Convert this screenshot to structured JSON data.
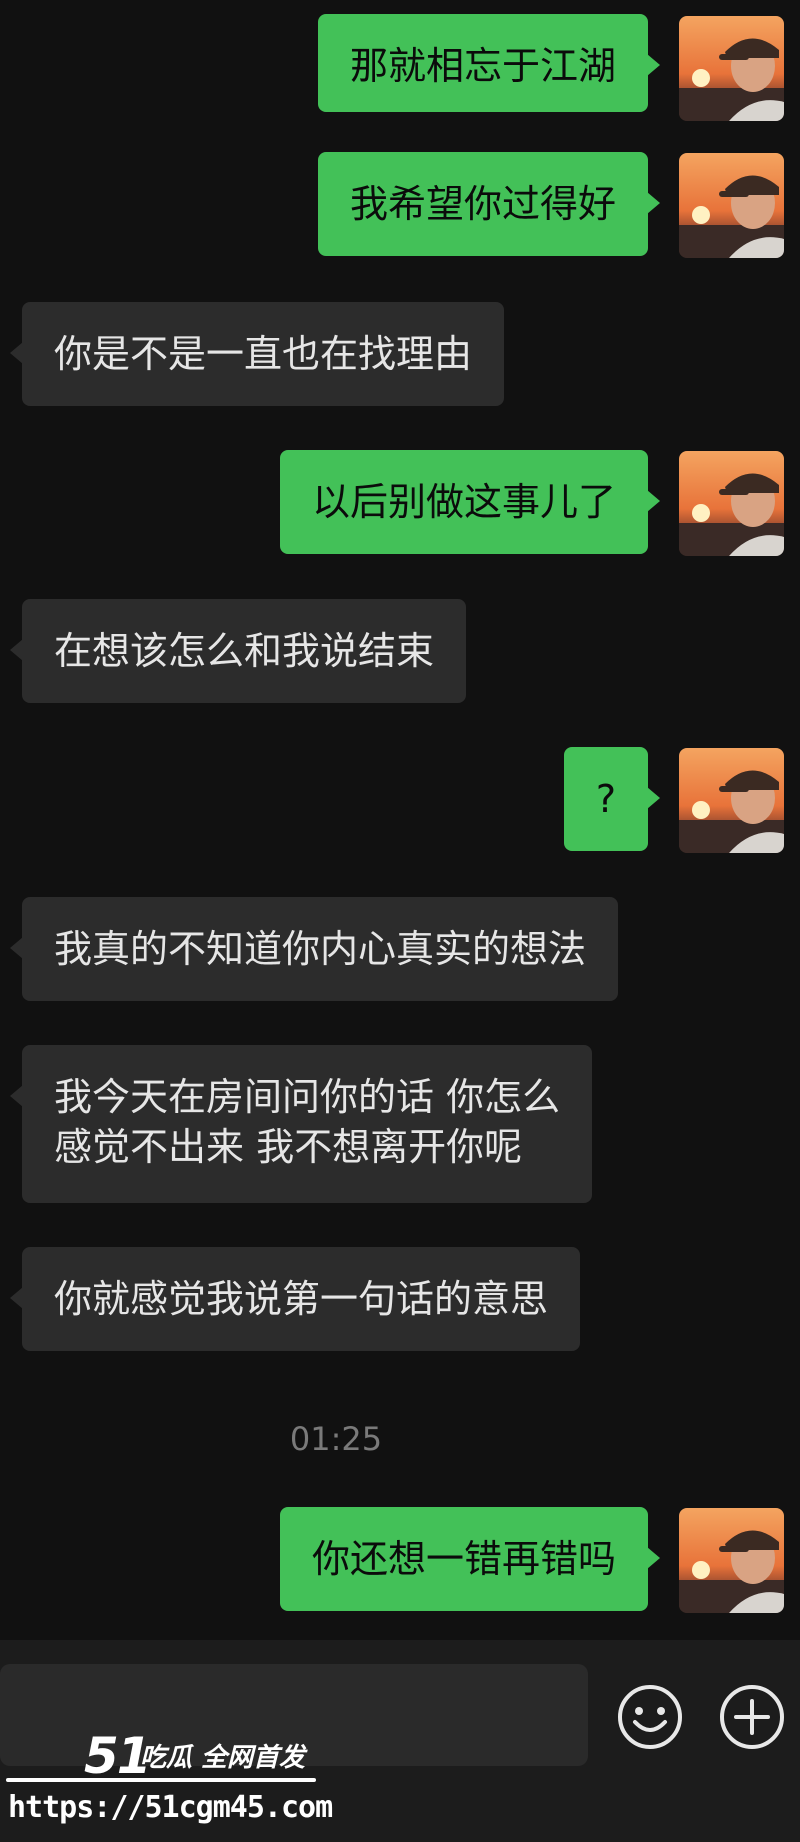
{
  "messages": [
    {
      "sender": "me",
      "text": "那就相忘于江湖"
    },
    {
      "sender": "me",
      "text": "我希望你过得好"
    },
    {
      "sender": "other",
      "text": "你是不是一直也在找理由"
    },
    {
      "sender": "me",
      "text": "以后别做这事儿了"
    },
    {
      "sender": "other",
      "text": "在想该怎么和我说结束"
    },
    {
      "sender": "me",
      "text": "?"
    },
    {
      "sender": "other",
      "text": "我真的不知道你内心真实的想法"
    },
    {
      "sender": "other",
      "text_line1": "我今天在房间问你的话 你怎么",
      "text_line2": "感觉不出来 我不想离开你呢"
    },
    {
      "sender": "other",
      "text": "你就感觉我说第一句话的意思"
    },
    {
      "sender": "me",
      "text": "你还想一错再错吗"
    }
  ],
  "timestamp": "01:25",
  "input_bar": {
    "emoji_icon": "emoji-icon",
    "add_icon": "plus-icon"
  },
  "watermark": {
    "logo": "51",
    "tagline": "吃瓜 全网首发",
    "url": "https://51cgm45.com"
  },
  "colors": {
    "background": "#111111",
    "my_bubble": "#43c158",
    "other_bubble": "#2c2c2c"
  }
}
